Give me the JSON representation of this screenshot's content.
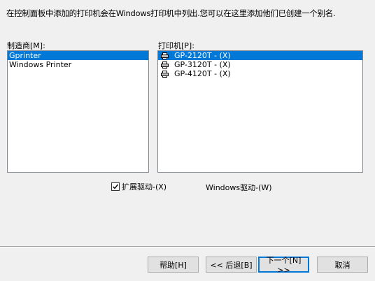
{
  "description": "在控制面板中添加的打印机会在Windows打印机中列出.您可以在这里添加他们已创建一个别名.",
  "manufacturer": {
    "label": "制造商[M]:",
    "items": [
      "Gprinter",
      "Windows Printer"
    ],
    "selected": 0
  },
  "printers": {
    "label": "打印机[P]:",
    "items": [
      "GP-2120T - (X)",
      "GP-3120T - (X)",
      "GP-4120T - (X)"
    ],
    "selected": 0,
    "icon": "printer-icon"
  },
  "extended_driver": {
    "label": "扩展驱动-(X)",
    "checked": true
  },
  "windows_driver_label": "Windows驱动-(W)",
  "buttons": {
    "help": "帮助[H]",
    "back": "<< 后退[B]",
    "next": "下一个[N] >>",
    "cancel": "取消"
  },
  "colors": {
    "selection": "#0078d7",
    "window_bg": "#f0f0f0"
  }
}
